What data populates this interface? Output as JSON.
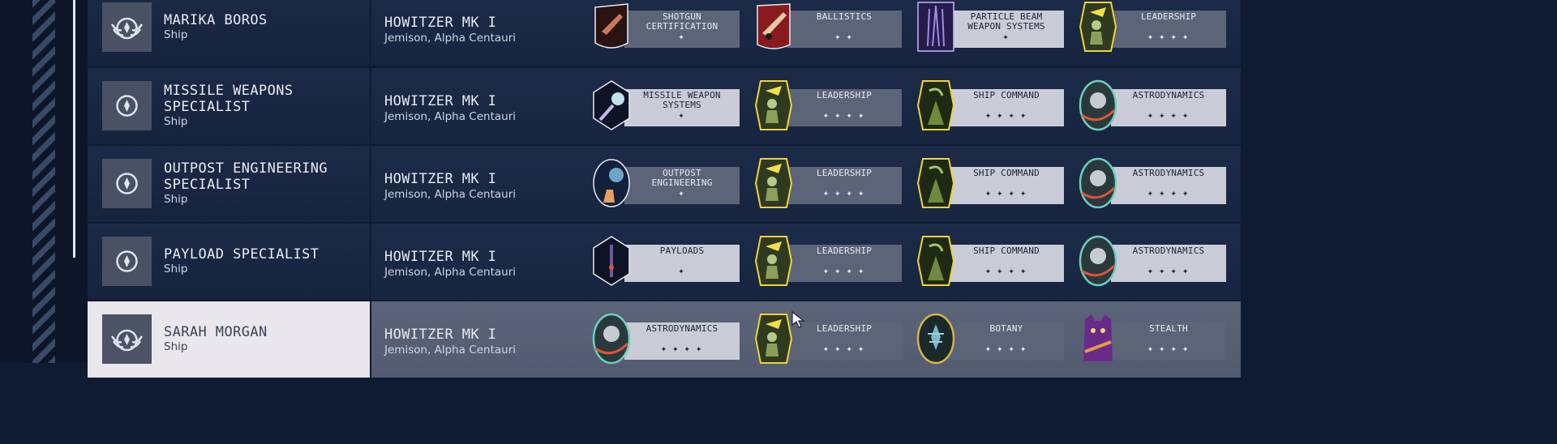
{
  "crew": [
    {
      "name": "MARIKA BOROS",
      "role": "Ship",
      "ship": "HOWITZER MK I",
      "location": "Jemison, Alpha Centauri",
      "skills": [
        {
          "name": "SHOTGUN\nCERTIFICATION",
          "stars": "✦",
          "icon": "shotgun-patch",
          "dim": true
        },
        {
          "name": "BALLISTICS",
          "stars": "✦ ✦",
          "icon": "ballistics-patch",
          "dim": true
        },
        {
          "name": "PARTICLE BEAM\nWEAPON SYSTEMS",
          "stars": "✦",
          "icon": "particle-beam-patch",
          "dim": false
        },
        {
          "name": "LEADERSHIP",
          "stars": "✦ ✦ ✦ ✦",
          "icon": "leadership-patch",
          "dim": true
        }
      ]
    },
    {
      "name": "MISSILE WEAPONS\nSPECIALIST",
      "role": "Ship",
      "ship": "HOWITZER MK I",
      "location": "Jemison, Alpha Centauri",
      "skills": [
        {
          "name": "MISSILE WEAPON\nSYSTEMS",
          "stars": "✦",
          "icon": "missile-patch",
          "dim": false
        },
        {
          "name": "LEADERSHIP",
          "stars": "✦ ✦ ✦ ✦",
          "icon": "leadership-patch",
          "dim": true
        },
        {
          "name": "SHIP COMMAND",
          "stars": "✦ ✦ ✦ ✦",
          "icon": "ship-command-patch",
          "dim": false
        },
        {
          "name": "ASTRODYNAMICS",
          "stars": "✦ ✦ ✦ ✦",
          "icon": "astrodynamics-patch",
          "dim": false
        }
      ]
    },
    {
      "name": "OUTPOST ENGINEERING\nSPECIALIST",
      "role": "Ship",
      "ship": "HOWITZER MK I",
      "location": "Jemison, Alpha Centauri",
      "skills": [
        {
          "name": "OUTPOST\nENGINEERING",
          "stars": "✦",
          "icon": "outpost-patch",
          "dim": true
        },
        {
          "name": "LEADERSHIP",
          "stars": "✦ ✦ ✦ ✦",
          "icon": "leadership-patch",
          "dim": true
        },
        {
          "name": "SHIP COMMAND",
          "stars": "✦ ✦ ✦ ✦",
          "icon": "ship-command-patch",
          "dim": false
        },
        {
          "name": "ASTRODYNAMICS",
          "stars": "✦ ✦ ✦ ✦",
          "icon": "astrodynamics-patch",
          "dim": false
        }
      ]
    },
    {
      "name": "PAYLOAD SPECIALIST",
      "role": "Ship",
      "ship": "HOWITZER MK I",
      "location": "Jemison, Alpha Centauri",
      "skills": [
        {
          "name": "PAYLOADS",
          "stars": "✦",
          "icon": "payloads-patch",
          "dim": false
        },
        {
          "name": "LEADERSHIP",
          "stars": "✦ ✦ ✦ ✦",
          "icon": "leadership-patch",
          "dim": true
        },
        {
          "name": "SHIP COMMAND",
          "stars": "✦ ✦ ✦ ✦",
          "icon": "ship-command-patch",
          "dim": false
        },
        {
          "name": "ASTRODYNAMICS",
          "stars": "✦ ✦ ✦ ✦",
          "icon": "astrodynamics-patch",
          "dim": false
        }
      ]
    },
    {
      "name": "SARAH MORGAN",
      "role": "Ship",
      "ship": "HOWITZER MK I",
      "location": "Jemison, Alpha Centauri",
      "skills": [
        {
          "name": "ASTRODYNAMICS",
          "stars": "✦ ✦ ✦ ✦",
          "icon": "astrodynamics-patch",
          "dim": false
        },
        {
          "name": "LEADERSHIP",
          "stars": "✦ ✦ ✦ ✦",
          "icon": "leadership-patch",
          "dim": true
        },
        {
          "name": "BOTANY",
          "stars": "✦ ✦ ✦ ✦",
          "icon": "botany-patch",
          "dim": true
        },
        {
          "name": "STEALTH",
          "stars": "✦ ✦ ✦ ✦",
          "icon": "stealth-patch",
          "dim": true
        }
      ]
    }
  ]
}
